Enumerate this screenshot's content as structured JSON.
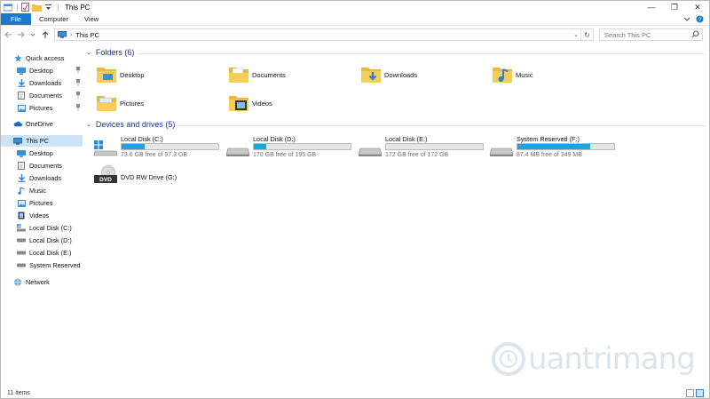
{
  "window": {
    "title": "This PC",
    "controls": {
      "minimize": "—",
      "maximize": "❐",
      "close": "✕"
    }
  },
  "ribbon": {
    "tabs": [
      "File",
      "Computer",
      "View"
    ],
    "help_icon": "?",
    "expand_icon": "chevron-down-icon"
  },
  "address": {
    "breadcrumb": "This PC",
    "separator": "›",
    "dropdown": "⌄",
    "refresh": "↻"
  },
  "search": {
    "placeholder": "Search This PC"
  },
  "nav": {
    "quick_access": "Quick access",
    "quick_items": [
      "Desktop",
      "Downloads",
      "Documents",
      "Pictures"
    ],
    "onedrive": "OneDrive",
    "this_pc": "This PC",
    "pc_items": [
      "Desktop",
      "Documents",
      "Downloads",
      "Music",
      "Pictures",
      "Videos",
      "Local Disk (C:)",
      "Local Disk (D:)",
      "Local Disk (E:)",
      "System Reserved (F:"
    ],
    "network": "Network"
  },
  "folders_section": {
    "title": "Folders (6)"
  },
  "folders": [
    "Desktop",
    "Documents",
    "Downloads",
    "Music",
    "Pictures",
    "Videos"
  ],
  "drives_section": {
    "title": "Devices and drives (5)"
  },
  "drives": [
    {
      "name": "Local Disk (C:)",
      "free": "73.6 GB free of 97.3 GB",
      "used_fraction": 0.24
    },
    {
      "name": "Local Disk (D:)",
      "free": "170 GB free of 195 GB",
      "used_fraction": 0.13
    },
    {
      "name": "Local Disk (E:)",
      "free": "172 GB free of 172 GB",
      "used_fraction": 0.0
    },
    {
      "name": "System Reserved (F:)",
      "free": "87.4 MB free of 349 MB",
      "used_fraction": 0.75
    }
  ],
  "dvd": {
    "name": "DVD RW Drive (G:)",
    "badge": "DVD"
  },
  "status": {
    "count": "11 items"
  },
  "colors": {
    "accent": "#1979ca",
    "folder": "#f0c24a",
    "bar_fill": "#26a0da",
    "header": "#1e3287"
  }
}
